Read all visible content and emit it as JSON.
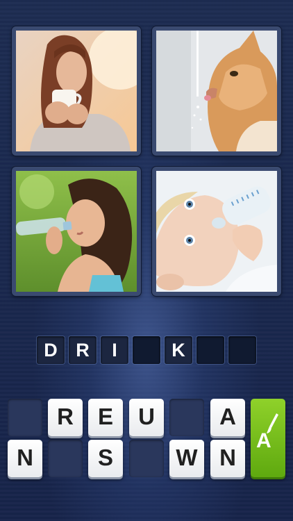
{
  "images": [
    {
      "name": "woman-drinking-coffee"
    },
    {
      "name": "cat-drinking-water"
    },
    {
      "name": "woman-drinking-bottled-water"
    },
    {
      "name": "baby-drinking-bottle"
    }
  ],
  "answer": {
    "slots": [
      "D",
      "R",
      "I",
      "",
      "K",
      "",
      ""
    ]
  },
  "keyboard": {
    "row1": [
      "",
      "R",
      "E",
      "U",
      "",
      "A"
    ],
    "row2": [
      "N",
      "",
      "S",
      "",
      "W",
      "N"
    ]
  },
  "hint": {
    "letter": "A",
    "icon": "paintbrush-icon",
    "color": "#7cc21f"
  },
  "colors": {
    "background": "#1b2a4e",
    "tile_frame": "#3a4a70",
    "key_face": "#ffffff",
    "hint_green": "#7cc21f"
  }
}
